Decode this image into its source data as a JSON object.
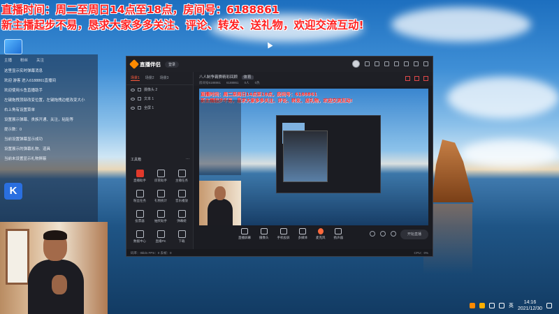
{
  "overlay": {
    "line1": "直播时间：周二至周日14点至18点，房间号：6188861",
    "line2": "新主播起步不易，恳求大家多多关注、评论、转发、送礼物，欢迎交流互动!"
  },
  "chat": {
    "header": [
      "主播",
      "粉丝",
      "关注"
    ],
    "messages": [
      "这里显示实时弹幕消息",
      "欢迎 游客 进入6188861直播间",
      "欢迎使用斗鱼直播助手",
      "左键拖拽顶部改变位置，左键拖拽边框改变大小",
      "右上角有设置菜单",
      "设置展示弹幕、贵族开通、关注，粘贴等",
      "提示数：0",
      "当前设置弹幕显示成功",
      "设置展示的弹幕礼物、道具",
      "当前未设置显示礼物屏蔽"
    ]
  },
  "app": {
    "name": "直播伴侣",
    "login_label": "登录",
    "scene_tabs": [
      "场景1",
      "场景2",
      "场景3"
    ],
    "sources": [
      "摄像头 2",
      "文本 1",
      "全屏 1"
    ],
    "tools_title": "工具箱",
    "tools_more": "···",
    "tools": [
      {
        "label": "直播助手",
        "hot": true
      },
      {
        "label": "房管助手",
        "hot": false
      },
      {
        "label": "主播任务",
        "hot": false
      },
      {
        "label": "粉丝任务",
        "hot": false
      },
      {
        "label": "礼物统计",
        "hot": false
      },
      {
        "label": "音乐播放",
        "hot": false
      },
      {
        "label": "投票器",
        "hot": false
      },
      {
        "label": "抽奖助手",
        "hot": false
      },
      {
        "label": "弹幕姬",
        "hot": false
      },
      {
        "label": "数据中心",
        "hot": false
      },
      {
        "label": "直播PK",
        "hot": false
      },
      {
        "label": "下载",
        "hot": false
      }
    ],
    "room_title": "八人制争霸赛精彩回顾",
    "room_tag": "体育",
    "room_meta": [
      "房间号6188861",
      "6188861",
      "0人",
      "0热"
    ],
    "toolbar": [
      {
        "label": "直播屏幕",
        "icon": "screen-icon"
      },
      {
        "label": "摄像头",
        "icon": "camera-icon"
      },
      {
        "label": "手机投屏",
        "icon": "phone-icon"
      },
      {
        "label": "多媒体",
        "icon": "media-icon"
      },
      {
        "label": "麦克风",
        "icon": "mic-icon"
      },
      {
        "label": "扬声器",
        "icon": "speaker-icon"
      }
    ],
    "start_label": "开始直播",
    "status_left": "码率：0kb/s  FPS：0  丢帧：0",
    "status_right": "CPU：0%"
  },
  "preview": {
    "line1": "直播时间：周二至周日14点至18点，房间号：6188861",
    "line2": "新主播起步不易，恳求大家多多关注、评论、转发、送礼物，欢迎交流互动!"
  },
  "taskbar": {
    "time": "14:16",
    "date": "2021/12/30",
    "ime": "英"
  }
}
